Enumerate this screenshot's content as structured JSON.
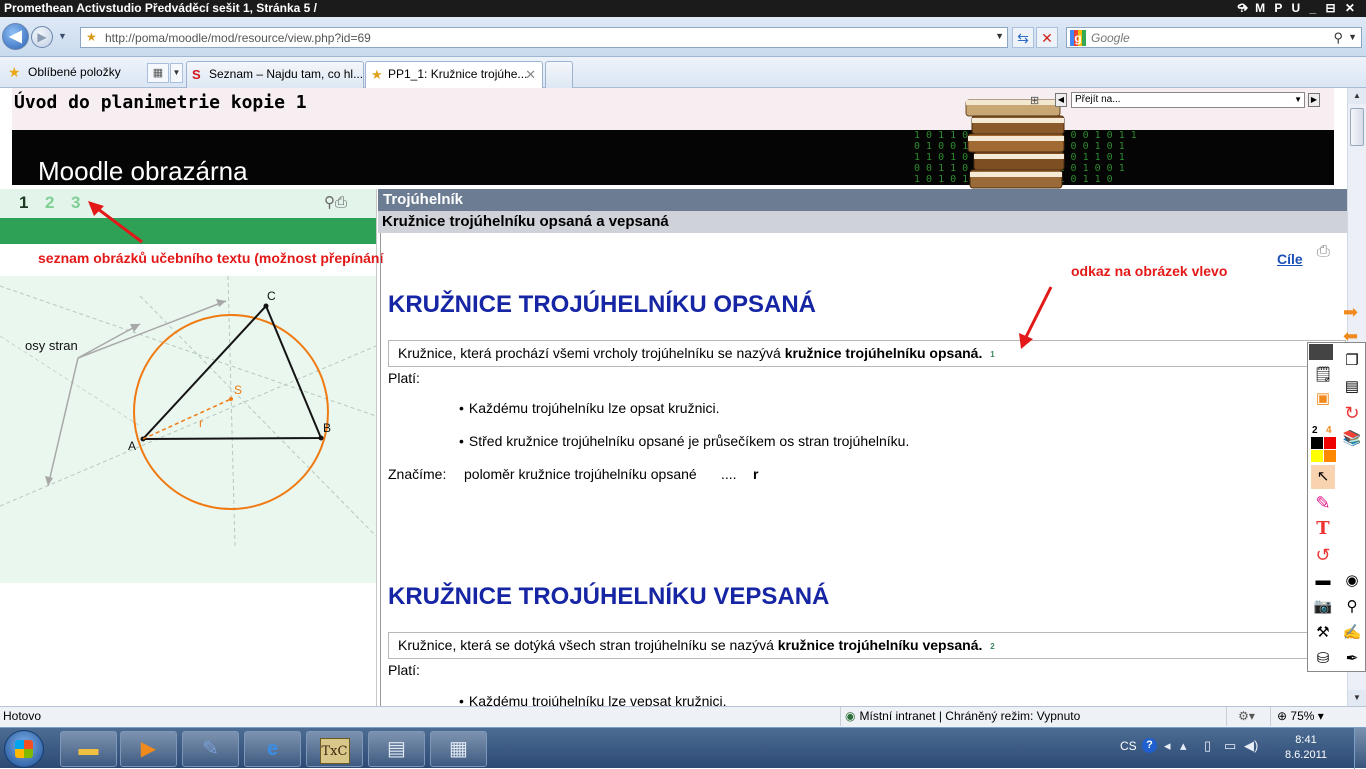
{
  "window": {
    "title": "Promethean Activstudio   Předváděcí sešit 1,  Stránka 5 /",
    "controls": "? M P U _ ⊟ ✕"
  },
  "browser": {
    "url": "http://poma/moodle/mod/resource/view.php?id=69",
    "search_placeholder": "Google",
    "favorites_label": "Oblíbené položky",
    "tabs": [
      {
        "label": "Seznam – Najdu tam, co hl..."
      },
      {
        "label": "PP1_1: Kružnice trojúhe..."
      }
    ]
  },
  "moodle": {
    "course_title": "Úvod do planimetrie kopie 1",
    "banner_title": "Moodle obrazárna",
    "jump_placeholder": "Přejít na...",
    "banner_digits": "1 0 1 1 0   0 1 1 0 1   1 0 0 1 0 1 1\n0 1 0 0 1 1 0 1 0 1 0 1 1 0 0 1 0 1\n1 1 0 1 0   1 0 1 1 0 1 0 0 1 1 0 1\n0 0 1 1 0 1 0   1 0 0 1 1 0 1 0 0 1\n1 0 1 0 1 1 0 1 0 1 0 0 1 0 1 1 0"
  },
  "left_panel": {
    "image_numbers": [
      "1",
      "2",
      "3"
    ],
    "annotation": "seznam obrázků učebního textu (možnost přepínání",
    "figure": {
      "label_osy": "osy stran",
      "vertex_a": "A",
      "vertex_b": "B",
      "vertex_c": "C",
      "center": "S",
      "radius": "r"
    }
  },
  "right_panel": {
    "section_title": "Trojúhelník",
    "section_subtitle": "Kružnice trojúhelníku opsaná a vepsaná",
    "cile_link": "Cíle",
    "annotation": "odkaz na obrázek vlevo",
    "heading_opsana": "KRUŽNICE TROJÚHELNÍKU OPSANÁ",
    "def_opsana_text": "Kružnice, která prochází všemi vrcholy trojúhelníku se nazývá",
    "def_opsana_term": "kružnice trojúhelníku opsaná.",
    "def_opsana_ref": "1",
    "plati": "Platí:",
    "bullets_opsana": [
      "Každému trojúhelníku lze opsat kružnici.",
      "Střed kružnice trojúhelníku opsané je průsečíkem os stran trojúhelníku."
    ],
    "znacime_label": "Značíme:",
    "znacime_desc": "poloměr kružnice trojúhelníku opsané",
    "znacime_dots": "....",
    "znacime_symbol": "r",
    "heading_vepsana": "KRUŽNICE TROJÚHELNÍKU VEPSANÁ",
    "def_vepsana_text": "Kružnice, která se dotýká všech stran trojúhelníku se nazývá",
    "def_vepsana_term": "kružnice trojúhelníku vepsaná.",
    "def_vepsana_ref": "2",
    "bullets_vepsana": [
      "Každému trojúhelníku lze vepsat kružnici."
    ]
  },
  "activstudio": {
    "palette_numbers": [
      "2",
      "4"
    ]
  },
  "statusbar": {
    "status": "Hotovo",
    "zone": "Místní intranet | Chráněný režim: Vypnuto",
    "zoom": "75%"
  },
  "taskbar": {
    "language": "CS",
    "time": "8:41",
    "date": "8.6.2011",
    "help": "?"
  },
  "colors": {
    "annotation_red": "#e31818",
    "heading_blue": "#1525a4",
    "moodle_green": "#2ea157",
    "circle_orange": "#f07a12"
  }
}
